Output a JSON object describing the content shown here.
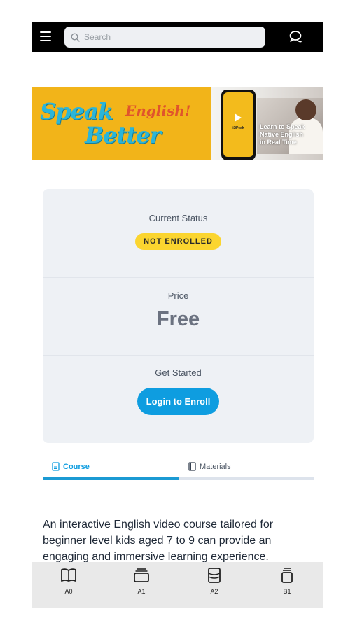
{
  "header": {
    "search_placeholder": "Search",
    "menu_icon": "hamburger-menu-icon",
    "chat_icon": "chat-bubbles-icon"
  },
  "banner": {
    "word1": "Speak",
    "word2": "English!",
    "word3": "Better",
    "phone_caption": "iSPeak",
    "photo_caption_line1": "Learn to Speak",
    "photo_caption_line2": "Native English",
    "photo_caption_line3": "in Real Time"
  },
  "status_card": {
    "status_label": "Current Status",
    "status_badge": "NOT ENROLLED",
    "price_label": "Price",
    "price_value": "Free",
    "cta_label": "Get Started",
    "cta_button": "Login to Enroll",
    "badge_color": "#fbd52f",
    "button_color": "#0e9de0"
  },
  "tabs": {
    "items": [
      {
        "label": "Course",
        "active": true
      },
      {
        "label": "Materials",
        "active": false
      }
    ],
    "progress_fraction": 0.5
  },
  "description": "An interactive English video course tailored for beginner level kids aged 7 to 9 can provide an engaging and immersive learning experience.",
  "bottom_nav": {
    "items": [
      {
        "label": "A0",
        "icon": "open-book-icon"
      },
      {
        "label": "A1",
        "icon": "stacked-cards-icon"
      },
      {
        "label": "A2",
        "icon": "layered-book-icon"
      },
      {
        "label": "B1",
        "icon": "book-stack-icon"
      }
    ]
  }
}
